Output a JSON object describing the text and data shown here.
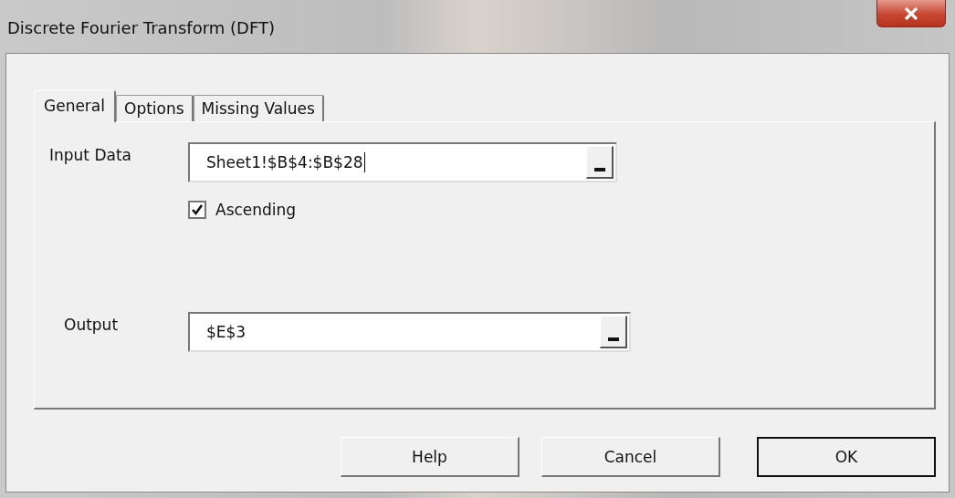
{
  "window": {
    "title": "Discrete Fourier Transform (DFT)"
  },
  "tabs": [
    {
      "label": "General",
      "selected": true
    },
    {
      "label": "Options",
      "selected": false
    },
    {
      "label": "Missing Values",
      "selected": false
    }
  ],
  "input_data": {
    "label": "Input Data",
    "value": "Sheet1!$B$4:$B$28",
    "focused": true
  },
  "ascending": {
    "label": "Ascending",
    "checked": true
  },
  "output": {
    "label": "Output",
    "value": "$E$3",
    "focused": false
  },
  "buttons": [
    {
      "label": "Help",
      "default": false
    },
    {
      "label": "Cancel",
      "default": false
    },
    {
      "label": "OK",
      "default": true
    }
  ]
}
